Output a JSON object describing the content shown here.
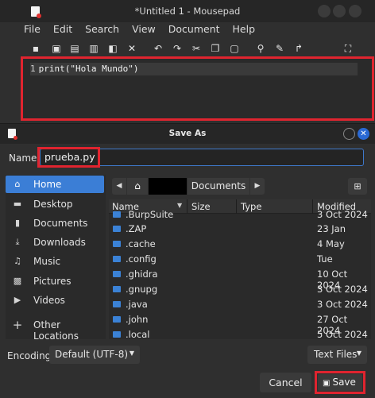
{
  "editor_window": {
    "title": "*Untitled 1 - Mousepad",
    "menu": [
      "File",
      "Edit",
      "Search",
      "View",
      "Document",
      "Help"
    ],
    "toolbar_icons": [
      "new-file-icon",
      "new-window-icon",
      "save-icon",
      "save-as-icon",
      "open-icon",
      "close-icon",
      "undo-icon",
      "redo-icon",
      "cut-icon",
      "copy-icon",
      "paste-icon",
      "search-icon",
      "replace-icon",
      "goto-icon",
      "fullscreen-icon"
    ],
    "line_number": "1",
    "code_line": "print(\"Hola Mundo\")"
  },
  "dialog": {
    "title": "Save As",
    "name_label": "Name:",
    "name_value": "prueba.py",
    "sidebar": [
      {
        "label": "Home",
        "icon": "home-icon",
        "active": true
      },
      {
        "label": "Desktop",
        "icon": "desktop-icon"
      },
      {
        "label": "Documents",
        "icon": "documents-icon"
      },
      {
        "label": "Downloads",
        "icon": "downloads-icon"
      },
      {
        "label": "Music",
        "icon": "music-icon"
      },
      {
        "label": "Pictures",
        "icon": "pictures-icon"
      },
      {
        "label": "Videos",
        "icon": "videos-icon"
      },
      {
        "label": "Other Locations",
        "icon": "plus-icon"
      }
    ],
    "path": {
      "current": "Documents"
    },
    "columns": {
      "name": "Name",
      "size": "Size",
      "type": "Type",
      "modified": "Modified"
    },
    "files": [
      {
        "name": ".BurpSuite",
        "modified": "3 Oct 2024"
      },
      {
        "name": ".ZAP",
        "modified": "23 Jan"
      },
      {
        "name": ".cache",
        "modified": "4 May"
      },
      {
        "name": ".config",
        "modified": "Tue"
      },
      {
        "name": ".ghidra",
        "modified": "10 Oct 2024"
      },
      {
        "name": ".gnupg",
        "modified": "3 Oct 2024"
      },
      {
        "name": ".java",
        "modified": "3 Oct 2024"
      },
      {
        "name": ".john",
        "modified": "27 Oct 2024"
      },
      {
        "name": ".local",
        "modified": "5 Oct 2024"
      }
    ],
    "encoding_label": "Encoding:",
    "encoding_value": "Default (UTF-8)",
    "file_type": "Text Files",
    "cancel_label": "Cancel",
    "save_label": "Save"
  }
}
